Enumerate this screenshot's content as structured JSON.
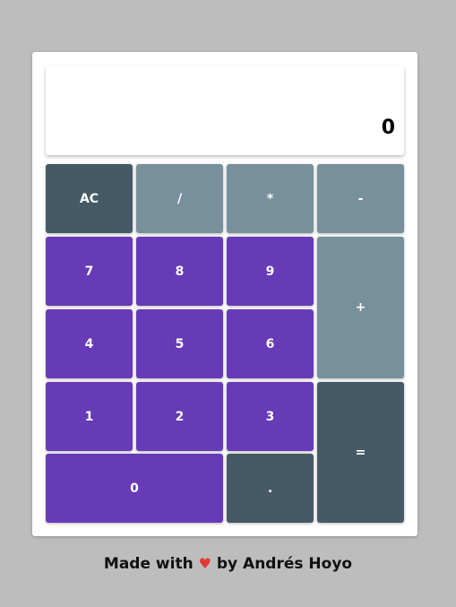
{
  "display": {
    "value": "0"
  },
  "keys": {
    "clear": "AC",
    "divide": "/",
    "multiply": "*",
    "subtract": "-",
    "add": "+",
    "equals": "=",
    "decimal": ".",
    "d0": "0",
    "d1": "1",
    "d2": "2",
    "d3": "3",
    "d4": "4",
    "d5": "5",
    "d6": "6",
    "d7": "7",
    "d8": "8",
    "d9": "9"
  },
  "footer": {
    "prefix": "Made with",
    "heart": "♥",
    "suffix": "by Andrés Hoyo"
  },
  "colors": {
    "background": "#bdbdbd",
    "number_key": "#673ab7",
    "operator_key": "#78909c",
    "dark_key": "#455a64",
    "heart": "#e53935"
  }
}
